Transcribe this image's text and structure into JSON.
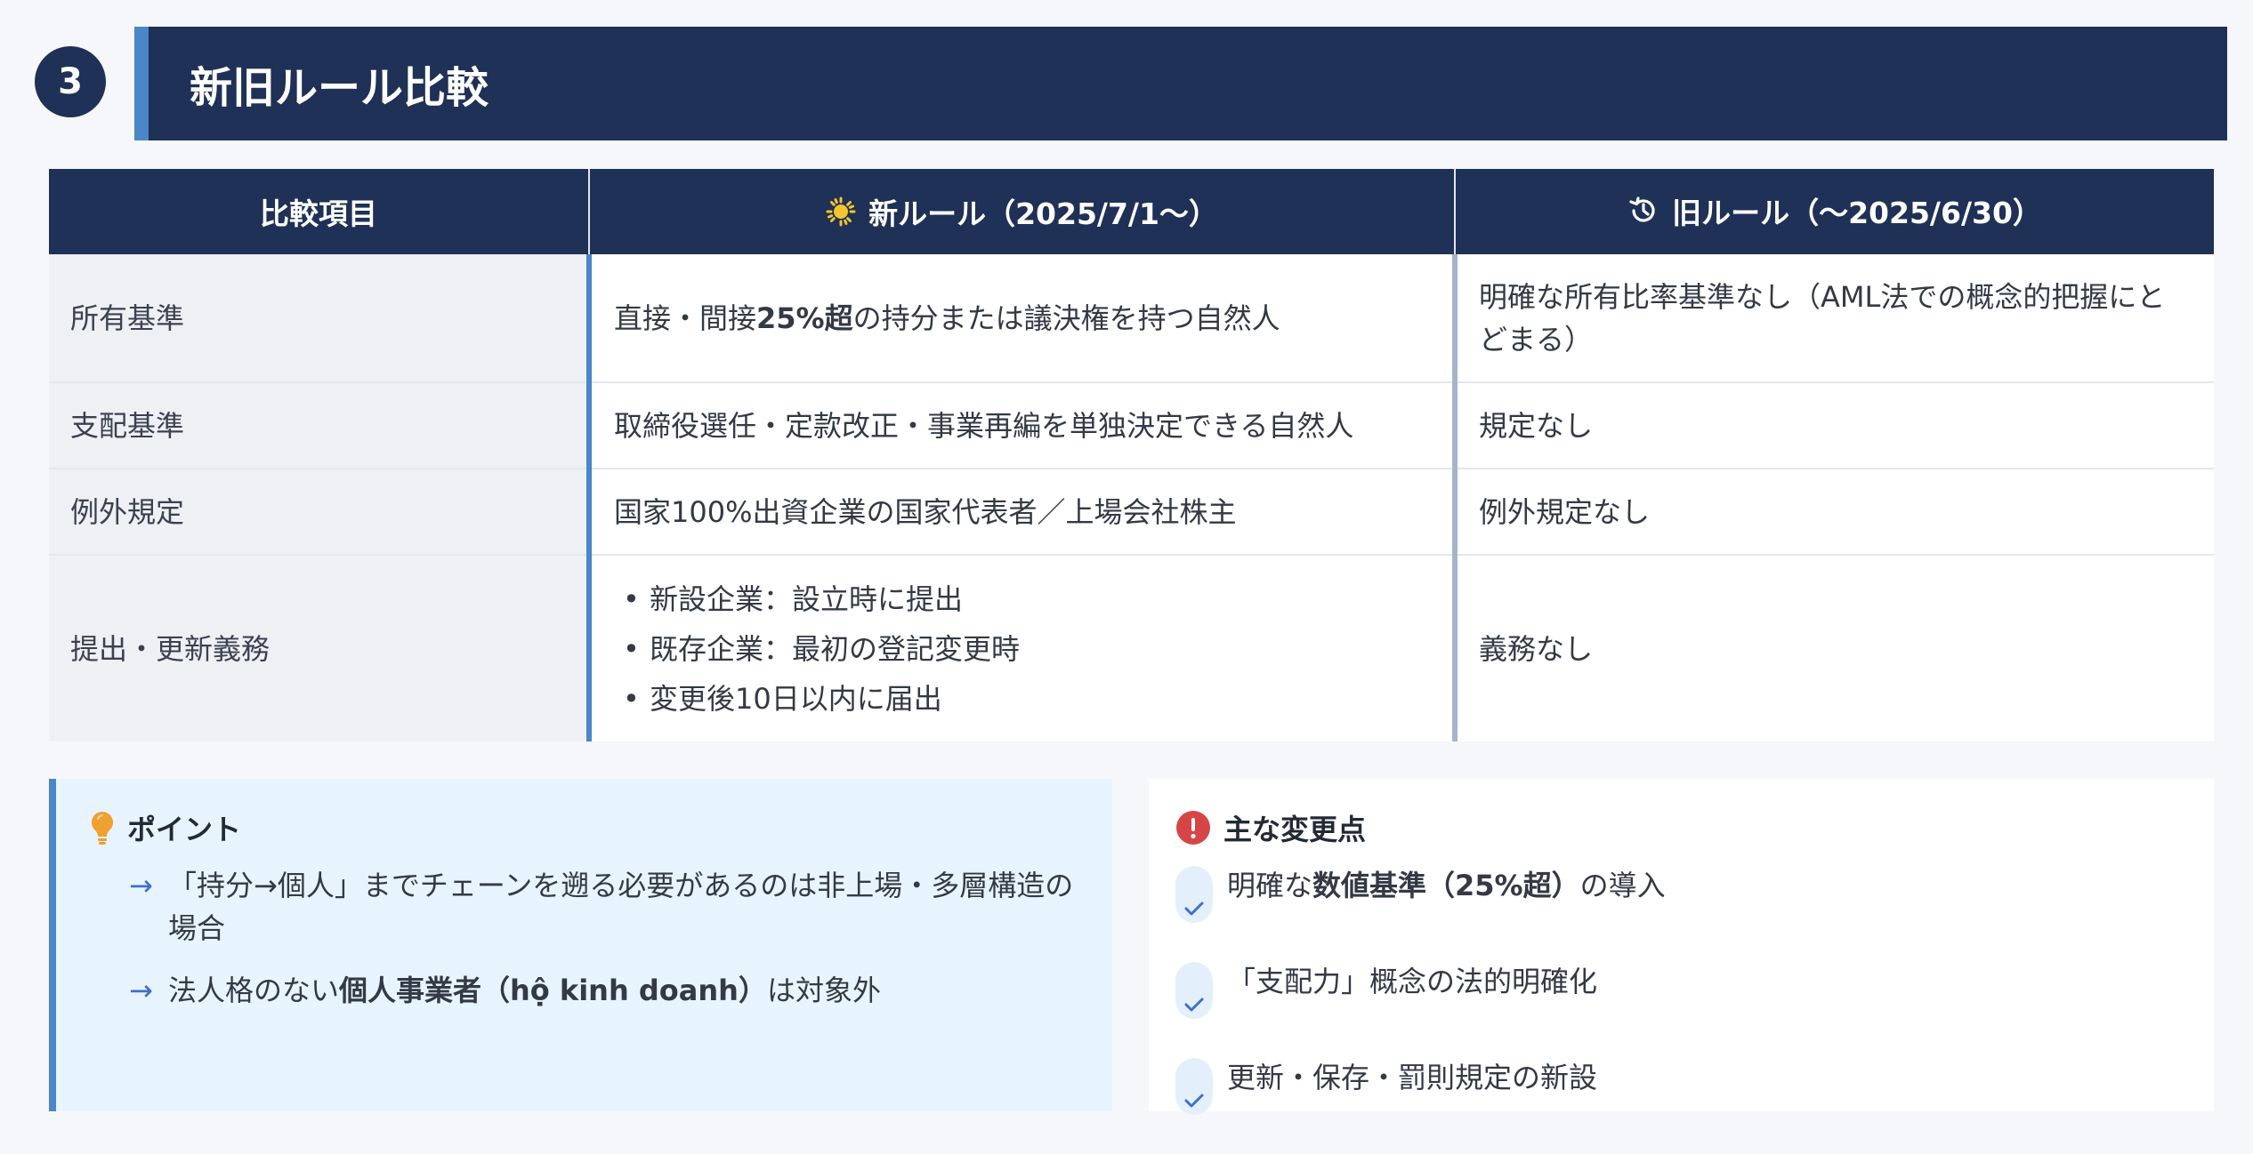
{
  "section": {
    "number": "3",
    "title": "新旧ルール比較"
  },
  "table": {
    "headers": {
      "item": "比較項目",
      "new": "新ルール（2025/7/1〜）",
      "old": "旧ルール（〜2025/6/30）"
    },
    "rows": [
      {
        "item": "所有基準",
        "new_pre": "直接・間接",
        "new_bold": "25%超",
        "new_post": "の持分または議決権を持つ自然人",
        "old": "明確な所有比率基準なし（AML法での概念的把握にとどまる）"
      },
      {
        "item": "支配基準",
        "new": "取締役選任・定款改正・事業再編を単独決定できる自然人",
        "old": "規定なし"
      },
      {
        "item": "例外規定",
        "new": "国家100%出資企業の国家代表者／上場会社株主",
        "old": "例外規定なし"
      },
      {
        "item": "提出・更新義務",
        "new_bullets": [
          "新設企業：設立時に提出",
          "既存企業：最初の登記変更時",
          "変更後10日以内に届出"
        ],
        "old": "義務なし"
      }
    ]
  },
  "points": {
    "title": "ポイント",
    "item1": "「持分→個人」までチェーンを遡る必要があるのは非上場・多層構造の場合",
    "item2_pre": "法人格のない",
    "item2_bold": "個人事業者（hộ kinh doanh）",
    "item2_post": "は対象外"
  },
  "changes": {
    "title": "主な変更点",
    "item1_pre": "明確な",
    "item1_bold": "数値基準（25%超）",
    "item1_post": "の導入",
    "item2": "「支配力」概念の法的明確化",
    "item3": "更新・保存・罰則規定の新設"
  },
  "colors": {
    "navy": "#1f3156",
    "accent_blue": "#4a86c8",
    "alert_red": "#d64545",
    "bulb_orange": "#f0a030",
    "sun_yellow": "#f4c430"
  }
}
